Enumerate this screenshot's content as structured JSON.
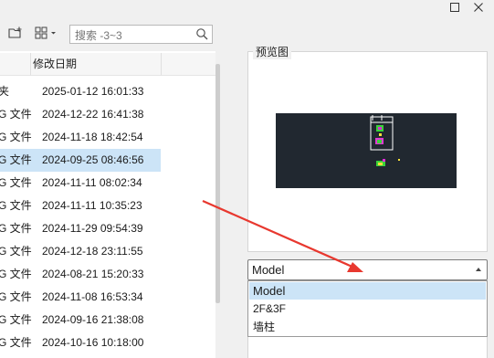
{
  "window": {
    "maximize_icon": "maximize-icon",
    "close_icon": "close-icon"
  },
  "toolbar": {
    "new_folder_icon": "new-folder-icon",
    "view_icon": "grid-view-icon",
    "search_placeholder": "搜索 -3~3"
  },
  "file_list": {
    "header_date": "修改日期",
    "rows": [
      {
        "type": "夹",
        "date": "2025-01-12 16:01:33"
      },
      {
        "type": "G 文件",
        "date": "2024-12-22 16:41:38"
      },
      {
        "type": "G 文件",
        "date": "2024-11-18 18:42:54"
      },
      {
        "type": "G 文件",
        "date": "2024-09-25 08:46:56",
        "selected": true
      },
      {
        "type": "G 文件",
        "date": "2024-11-11 08:02:34"
      },
      {
        "type": "G 文件",
        "date": "2024-11-11 10:35:23"
      },
      {
        "type": "G 文件",
        "date": "2024-11-29 09:54:39"
      },
      {
        "type": "G 文件",
        "date": "2024-12-18 23:11:55"
      },
      {
        "type": "G 文件",
        "date": "2024-08-21 15:20:33"
      },
      {
        "type": "G 文件",
        "date": "2024-11-08 16:53:34"
      },
      {
        "type": "G 文件",
        "date": "2024-09-16 21:38:08"
      },
      {
        "type": "G 文件",
        "date": "2024-10-16 10:18:00"
      }
    ]
  },
  "preview": {
    "label": "预览图"
  },
  "layout_select": {
    "value": "Model",
    "options": [
      "Model",
      "2F&3F",
      "墙柱"
    ],
    "selected_index": 0
  },
  "annotation": {
    "color": "#e8382f"
  }
}
